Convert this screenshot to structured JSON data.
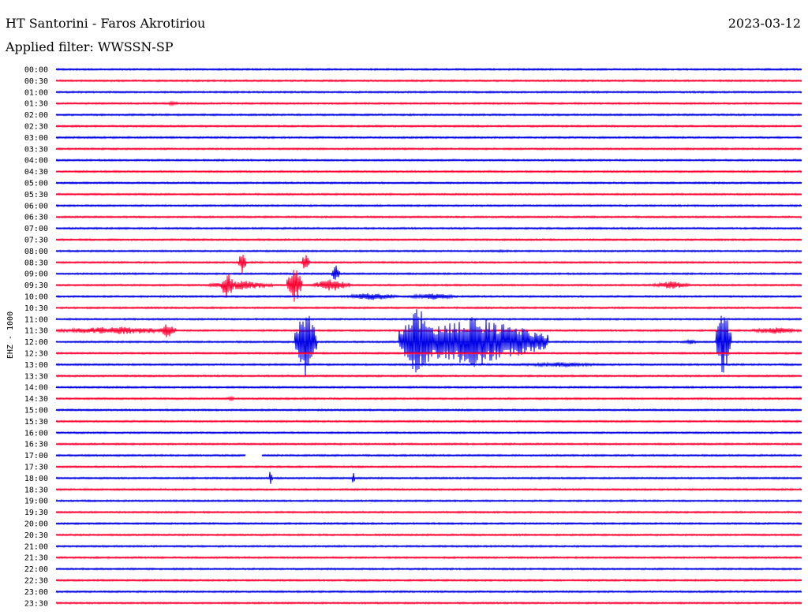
{
  "header": {
    "station": "HT Santorini - Faros Akrotiriou",
    "date": "2023-03-12",
    "filter": "Applied filter: WWSSN-SP"
  },
  "chart_data": {
    "type": "line",
    "title": "HT Santorini - Faros Akrotiriou",
    "channel_label": "EHZ - 1000",
    "colors": {
      "even_hour": "#0000e6",
      "half_hour": "#ff0033"
    },
    "rows": [
      "00:00",
      "00:30",
      "01:00",
      "01:30",
      "02:00",
      "02:30",
      "03:00",
      "03:30",
      "04:00",
      "04:30",
      "05:00",
      "05:30",
      "06:00",
      "06:30",
      "07:00",
      "07:30",
      "08:00",
      "08:30",
      "09:00",
      "09:30",
      "10:00",
      "10:30",
      "11:00",
      "11:30",
      "12:00",
      "12:30",
      "13:00",
      "13:30",
      "14:00",
      "14:30",
      "15:00",
      "15:30",
      "16:00",
      "16:30",
      "17:00",
      "17:30",
      "18:00",
      "18:30",
      "19:00",
      "19:30",
      "20:00",
      "20:30",
      "21:00",
      "21:30",
      "22:00",
      "22:30",
      "23:00",
      "23:30"
    ],
    "events": [
      {
        "row": "01:30",
        "start": 0.149,
        "end": 0.165,
        "amp": 3
      },
      {
        "row": "08:00",
        "start": 0.56,
        "end": 0.63,
        "amp": 1.5
      },
      {
        "row": "08:30",
        "start": 0.655,
        "end": 0.99,
        "amp": 1.2
      },
      {
        "row": "08:30",
        "start": 0.245,
        "end": 0.255,
        "amp": 16
      },
      {
        "row": "08:30",
        "start": 0.33,
        "end": 0.34,
        "amp": 14
      },
      {
        "row": "09:00",
        "start": 0.37,
        "end": 0.38,
        "amp": 12
      },
      {
        "row": "09:30",
        "start": 0.205,
        "end": 0.29,
        "amp": 6
      },
      {
        "row": "09:30",
        "start": 0.222,
        "end": 0.238,
        "amp": 20
      },
      {
        "row": "09:30",
        "start": 0.31,
        "end": 0.33,
        "amp": 24
      },
      {
        "row": "09:30",
        "start": 0.345,
        "end": 0.395,
        "amp": 8
      },
      {
        "row": "09:30",
        "start": 0.8,
        "end": 0.85,
        "amp": 5
      },
      {
        "row": "10:00",
        "start": 0.39,
        "end": 0.46,
        "amp": 5
      },
      {
        "row": "10:00",
        "start": 0.47,
        "end": 0.54,
        "amp": 4
      },
      {
        "row": "11:30",
        "start": 0.0,
        "end": 0.16,
        "amp": 5
      },
      {
        "row": "11:30",
        "start": 0.14,
        "end": 0.16,
        "amp": 10
      },
      {
        "row": "11:30",
        "start": 0.93,
        "end": 1.0,
        "amp": 4
      },
      {
        "row": "12:00",
        "start": 0.32,
        "end": 0.35,
        "amp": 45
      },
      {
        "row": "12:00",
        "start": 0.46,
        "end": 0.66,
        "amp": 32
      },
      {
        "row": "12:00",
        "start": 0.46,
        "end": 0.51,
        "amp": 45
      },
      {
        "row": "12:00",
        "start": 0.885,
        "end": 0.905,
        "amp": 45
      },
      {
        "row": "12:00",
        "start": 0.84,
        "end": 0.86,
        "amp": 4
      },
      {
        "row": "13:00",
        "start": 0.61,
        "end": 0.74,
        "amp": 3
      },
      {
        "row": "14:30",
        "start": 0.228,
        "end": 0.24,
        "amp": 3
      },
      {
        "row": "18:00",
        "start": 0.286,
        "end": 0.29,
        "amp": 14
      },
      {
        "row": "18:00",
        "start": 0.397,
        "end": 0.401,
        "amp": 14
      }
    ],
    "gaps": [
      {
        "row": "17:00",
        "start": 0.254,
        "end": 0.276
      }
    ],
    "grid": false
  }
}
